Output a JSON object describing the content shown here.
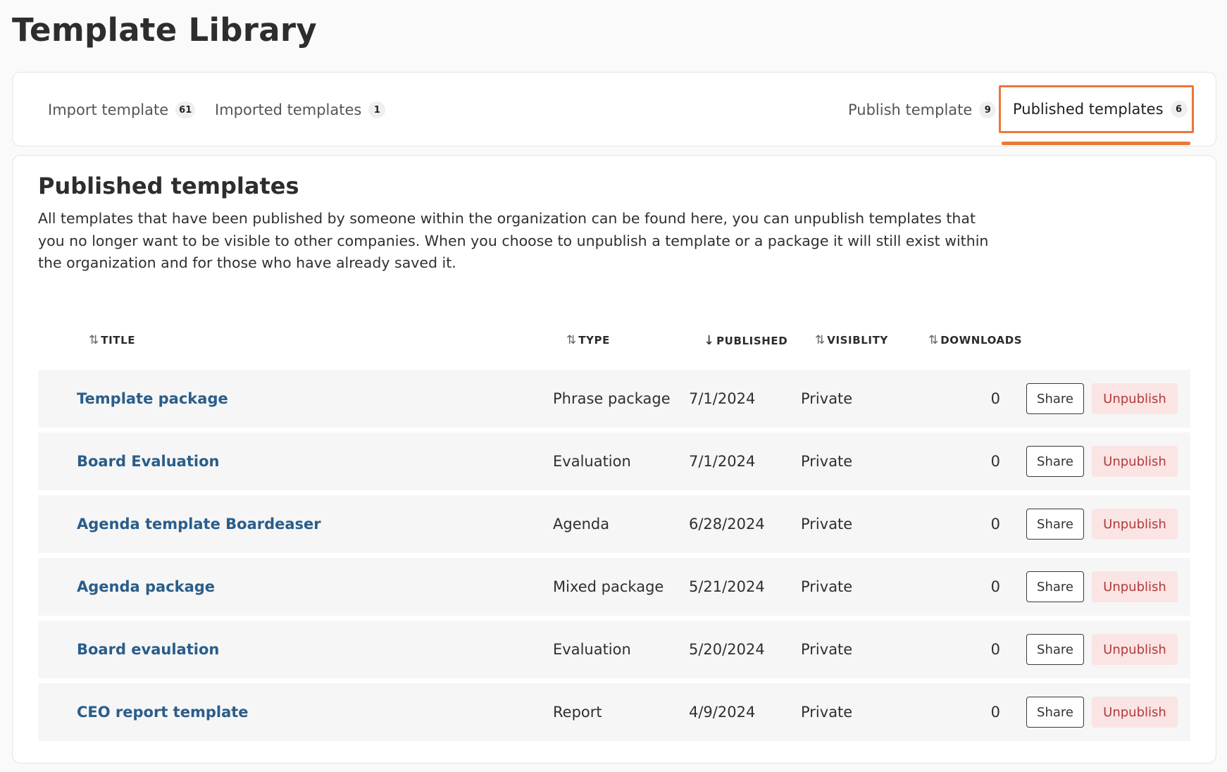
{
  "page": {
    "title": "Template Library"
  },
  "tabs": [
    {
      "label": "Import template",
      "count": "61"
    },
    {
      "label": "Imported templates",
      "count": "1"
    },
    {
      "label": "Publish template",
      "count": "9"
    },
    {
      "label": "Published templates",
      "count": "6",
      "active": true
    }
  ],
  "accent_color": "#e8793a",
  "section": {
    "title": "Published templates",
    "description": "All templates that have been published by someone within the organization can be found here, you can unpublish templates that you no longer want to be visible to other companies. When you choose to unpublish a template or a package it will still exist within the organization and for those who have already saved it."
  },
  "table": {
    "columns": {
      "title": "TITLE",
      "type": "TYPE",
      "published": "PUBLISHED",
      "visibility": "VISIBLITY",
      "downloads": "DOWNLOADS"
    },
    "sort_icons": {
      "unsorted": "⇅",
      "descending": "↓"
    },
    "share_label": "Share",
    "unpublish_label": "Unpublish",
    "rows": [
      {
        "title": "Template package",
        "type": "Phrase package",
        "published": "7/1/2024",
        "visibility": "Private",
        "downloads": "0"
      },
      {
        "title": "Board Evaluation",
        "type": "Evaluation",
        "published": "7/1/2024",
        "visibility": "Private",
        "downloads": "0"
      },
      {
        "title": "Agenda template Boardeaser",
        "type": "Agenda",
        "published": "6/28/2024",
        "visibility": "Private",
        "downloads": "0"
      },
      {
        "title": "Agenda package",
        "type": "Mixed package",
        "published": "5/21/2024",
        "visibility": "Private",
        "downloads": "0"
      },
      {
        "title": "Board evaulation",
        "type": "Evaluation",
        "published": "5/20/2024",
        "visibility": "Private",
        "downloads": "0"
      },
      {
        "title": "CEO report template",
        "type": "Report",
        "published": "4/9/2024",
        "visibility": "Private",
        "downloads": "0"
      }
    ]
  }
}
